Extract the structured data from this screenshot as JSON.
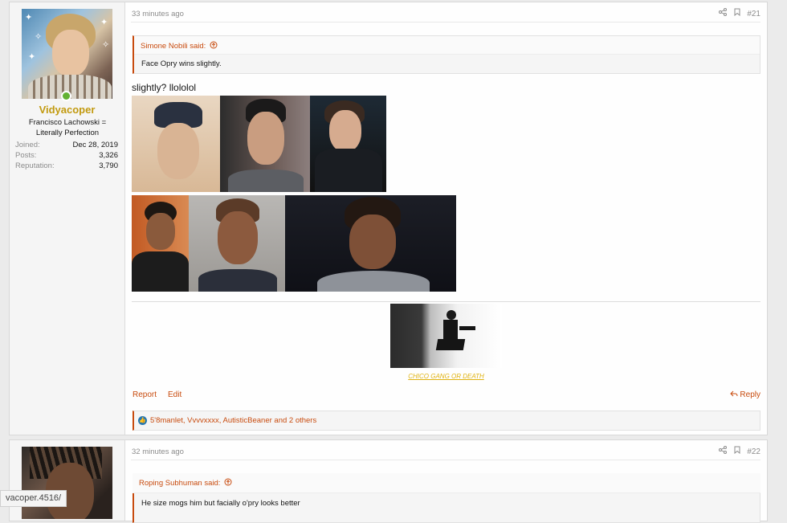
{
  "posts": [
    {
      "user": {
        "name": "Vidyacoper",
        "title": "Francisco Lachowski = Literally Perfection",
        "stats": [
          {
            "label": "Joined:",
            "value": "Dec 28, 2019"
          },
          {
            "label": "Posts:",
            "value": "3,326"
          },
          {
            "label": "Reputation:",
            "value": "3,790"
          }
        ]
      },
      "time": "33 minutes ago",
      "number": "#21",
      "quote": {
        "author": "Simone Nobili said:",
        "text": "Face Opry wins slightly."
      },
      "body": "slightly? llololol",
      "signature_caption": "CHICO GANG OR DEATH",
      "actions": {
        "report": "Report",
        "edit": "Edit",
        "reply": "Reply"
      },
      "reactions": "5'8manlet, Vvvvxxxx, AutisticBeaner and 2 others"
    },
    {
      "time": "32 minutes ago",
      "number": "#22",
      "quote": {
        "author": "Roping Subhuman said:",
        "text": "He size mogs him but facially o'pry looks better"
      }
    }
  ],
  "status_url": "vacoper.4516/",
  "icons": {
    "share": "share-icon",
    "bookmark": "bookmark-icon",
    "quote_arrow": "arrow-up-circle-icon",
    "reply": "reply-arrow-icon",
    "like": "thumbs-up-icon",
    "online": "online-status-icon"
  },
  "colors": {
    "accent": "#c84b0e",
    "username": "#c29a0f",
    "like": "#2577b1",
    "online": "#63b233",
    "signature_link": "#e0b20f"
  }
}
